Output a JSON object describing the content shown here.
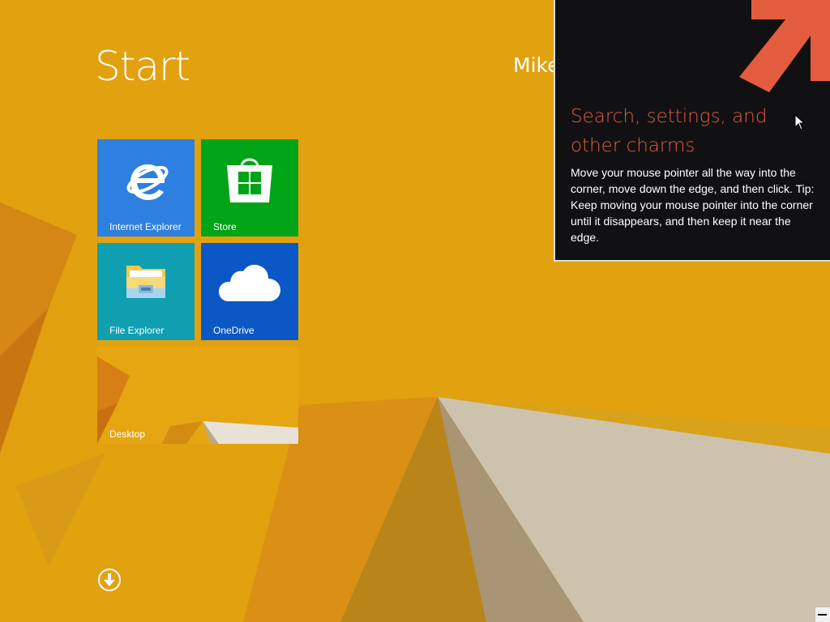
{
  "start": {
    "title": "Start",
    "user_name": "Mike"
  },
  "tiles": [
    {
      "label": "Internet Explorer",
      "color": "#2d7fe0",
      "icon": "internet-explorer-icon"
    },
    {
      "label": "Store",
      "color": "#00a416",
      "icon": "store-icon"
    },
    {
      "label": "File Explorer",
      "color": "#0f9fb0",
      "icon": "folder-icon"
    },
    {
      "label": "OneDrive",
      "color": "#0b57c5",
      "icon": "cloud-icon"
    },
    {
      "label": "Desktop",
      "color": "#e5a612",
      "icon": "desktop-wallpaper"
    }
  ],
  "apps_button": {
    "icon": "down-arrow-circle-icon"
  },
  "tip": {
    "title": "Search, settings, and other charms",
    "body": "Move your mouse pointer all the way into the corner, move down the edge, and then click. Tip: Keep moving your mouse pointer into the corner until it disappears, and then keep it near the edge.",
    "accent_color": "#e45c3e",
    "background_color": "#111113",
    "arrow_icon": "corner-arrow-icon"
  },
  "theme": {
    "background": "#e2a10f"
  }
}
